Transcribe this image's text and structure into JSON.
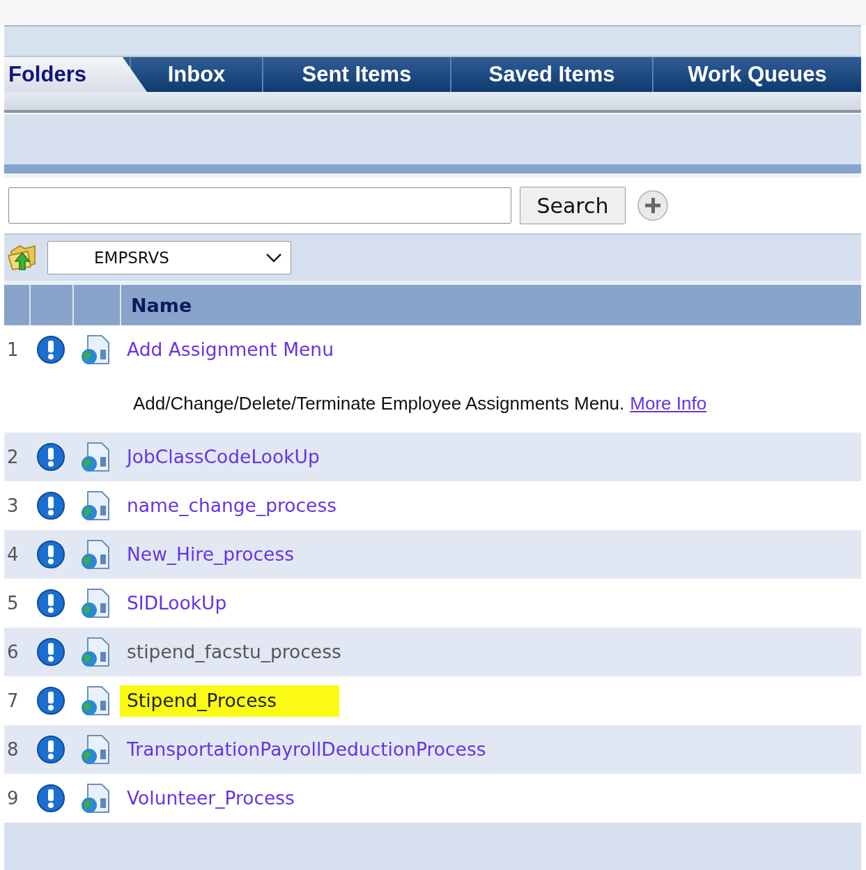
{
  "tabs": [
    {
      "label": "Folders",
      "selected": true
    },
    {
      "label": "Inbox",
      "selected": false
    },
    {
      "label": "Sent Items",
      "selected": false
    },
    {
      "label": "Saved Items",
      "selected": false
    },
    {
      "label": "Work Queues",
      "selected": false
    }
  ],
  "search": {
    "button": "Search"
  },
  "folder_select": {
    "value": "EMPSRVS"
  },
  "table": {
    "columns": [
      "Name"
    ],
    "rows": [
      {
        "number": "1",
        "name": "Add Assignment Menu",
        "visited": false,
        "highlighted": false,
        "description": "Add/Change/Delete/Terminate Employee Assignments Menu.",
        "link": "More Info"
      },
      {
        "number": "2",
        "name": "JobClassCodeLookUp",
        "visited": false,
        "highlighted": false
      },
      {
        "number": "3",
        "name": "name_change_process",
        "visited": false,
        "highlighted": false
      },
      {
        "number": "4",
        "name": "New_Hire_process",
        "visited": false,
        "highlighted": false
      },
      {
        "number": "5",
        "name": "SIDLookUp",
        "visited": false,
        "highlighted": false
      },
      {
        "number": "6",
        "name": "stipend_facstu_process",
        "visited": true,
        "highlighted": false
      },
      {
        "number": "7",
        "name": "Stipend_Process",
        "visited": false,
        "highlighted": true
      },
      {
        "number": "8",
        "name": "TransportationPayrollDeductionProcess",
        "visited": false,
        "highlighted": false
      },
      {
        "number": "9",
        "name": "Volunteer_Process",
        "visited": false,
        "highlighted": false
      }
    ]
  }
}
